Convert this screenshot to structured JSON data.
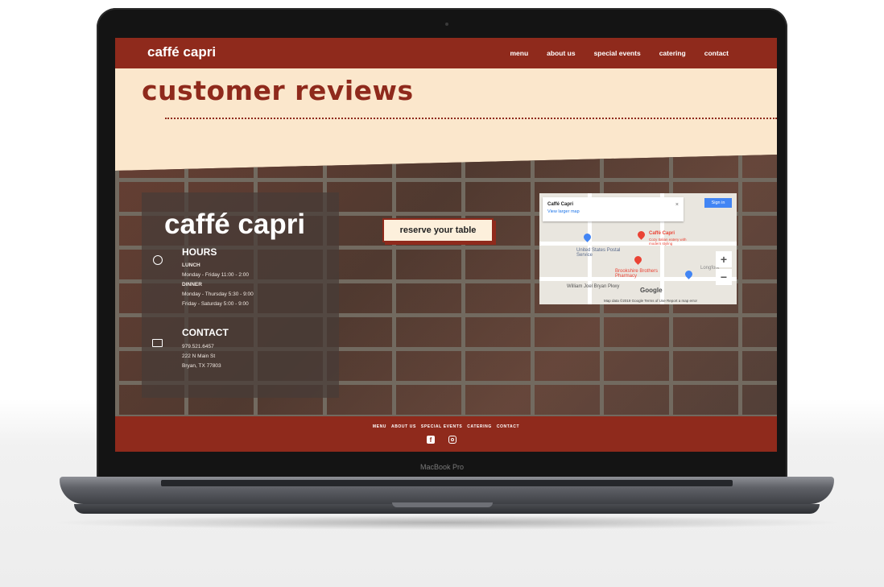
{
  "laptop": {
    "label": "MacBook Pro"
  },
  "site": {
    "brand": "caffé capri",
    "nav": [
      "menu",
      "about us",
      "special events",
      "catering",
      "contact"
    ],
    "page_title": "customer reviews"
  },
  "info": {
    "brand": "caffé capri",
    "hours_heading": "HOURS",
    "lunch_label": "LUNCH",
    "lunch_hours": "Monday - Friday 11:00 - 2:00",
    "dinner_label": "DINNER",
    "dinner_hours_1": "Monday - Thursday 5:30 - 9:00",
    "dinner_hours_2": "Friday - Saturday 5:00 - 9:00",
    "contact_heading": "CONTACT",
    "phone": "979.521.6457",
    "address_1": "222 N Main St",
    "address_2": "Bryan, TX 77803"
  },
  "reserve_button": "reserve your table",
  "map": {
    "place_title": "Caffé Capri",
    "view_larger": "View larger map",
    "close_glyph": "×",
    "sign_in": "Sign in",
    "pin_label": "Caffé Capri",
    "pin_sublabel": "Cozy Italian eatery with modern styling",
    "post_office": "United States Postal Service",
    "pharmacy": "Brookshire Brothers Pharmacy",
    "longfork": "Longfork",
    "street": "William Joel Bryan Pkwy",
    "google": "Google",
    "zoom_in": "+",
    "zoom_out": "−",
    "footer": "Map data ©2019 Google   Terms of Use   Report a map error",
    "pin_color": "#ea4335",
    "poi_color": "#4285f4"
  },
  "footer": {
    "links": [
      "MENU",
      "ABOUT US",
      "SPECIAL EVENTS",
      "CATERING",
      "CONTACT"
    ],
    "facebook_glyph": "f"
  },
  "colors": {
    "brand_red": "#8f2a1c",
    "cream": "#fbe7cc"
  }
}
